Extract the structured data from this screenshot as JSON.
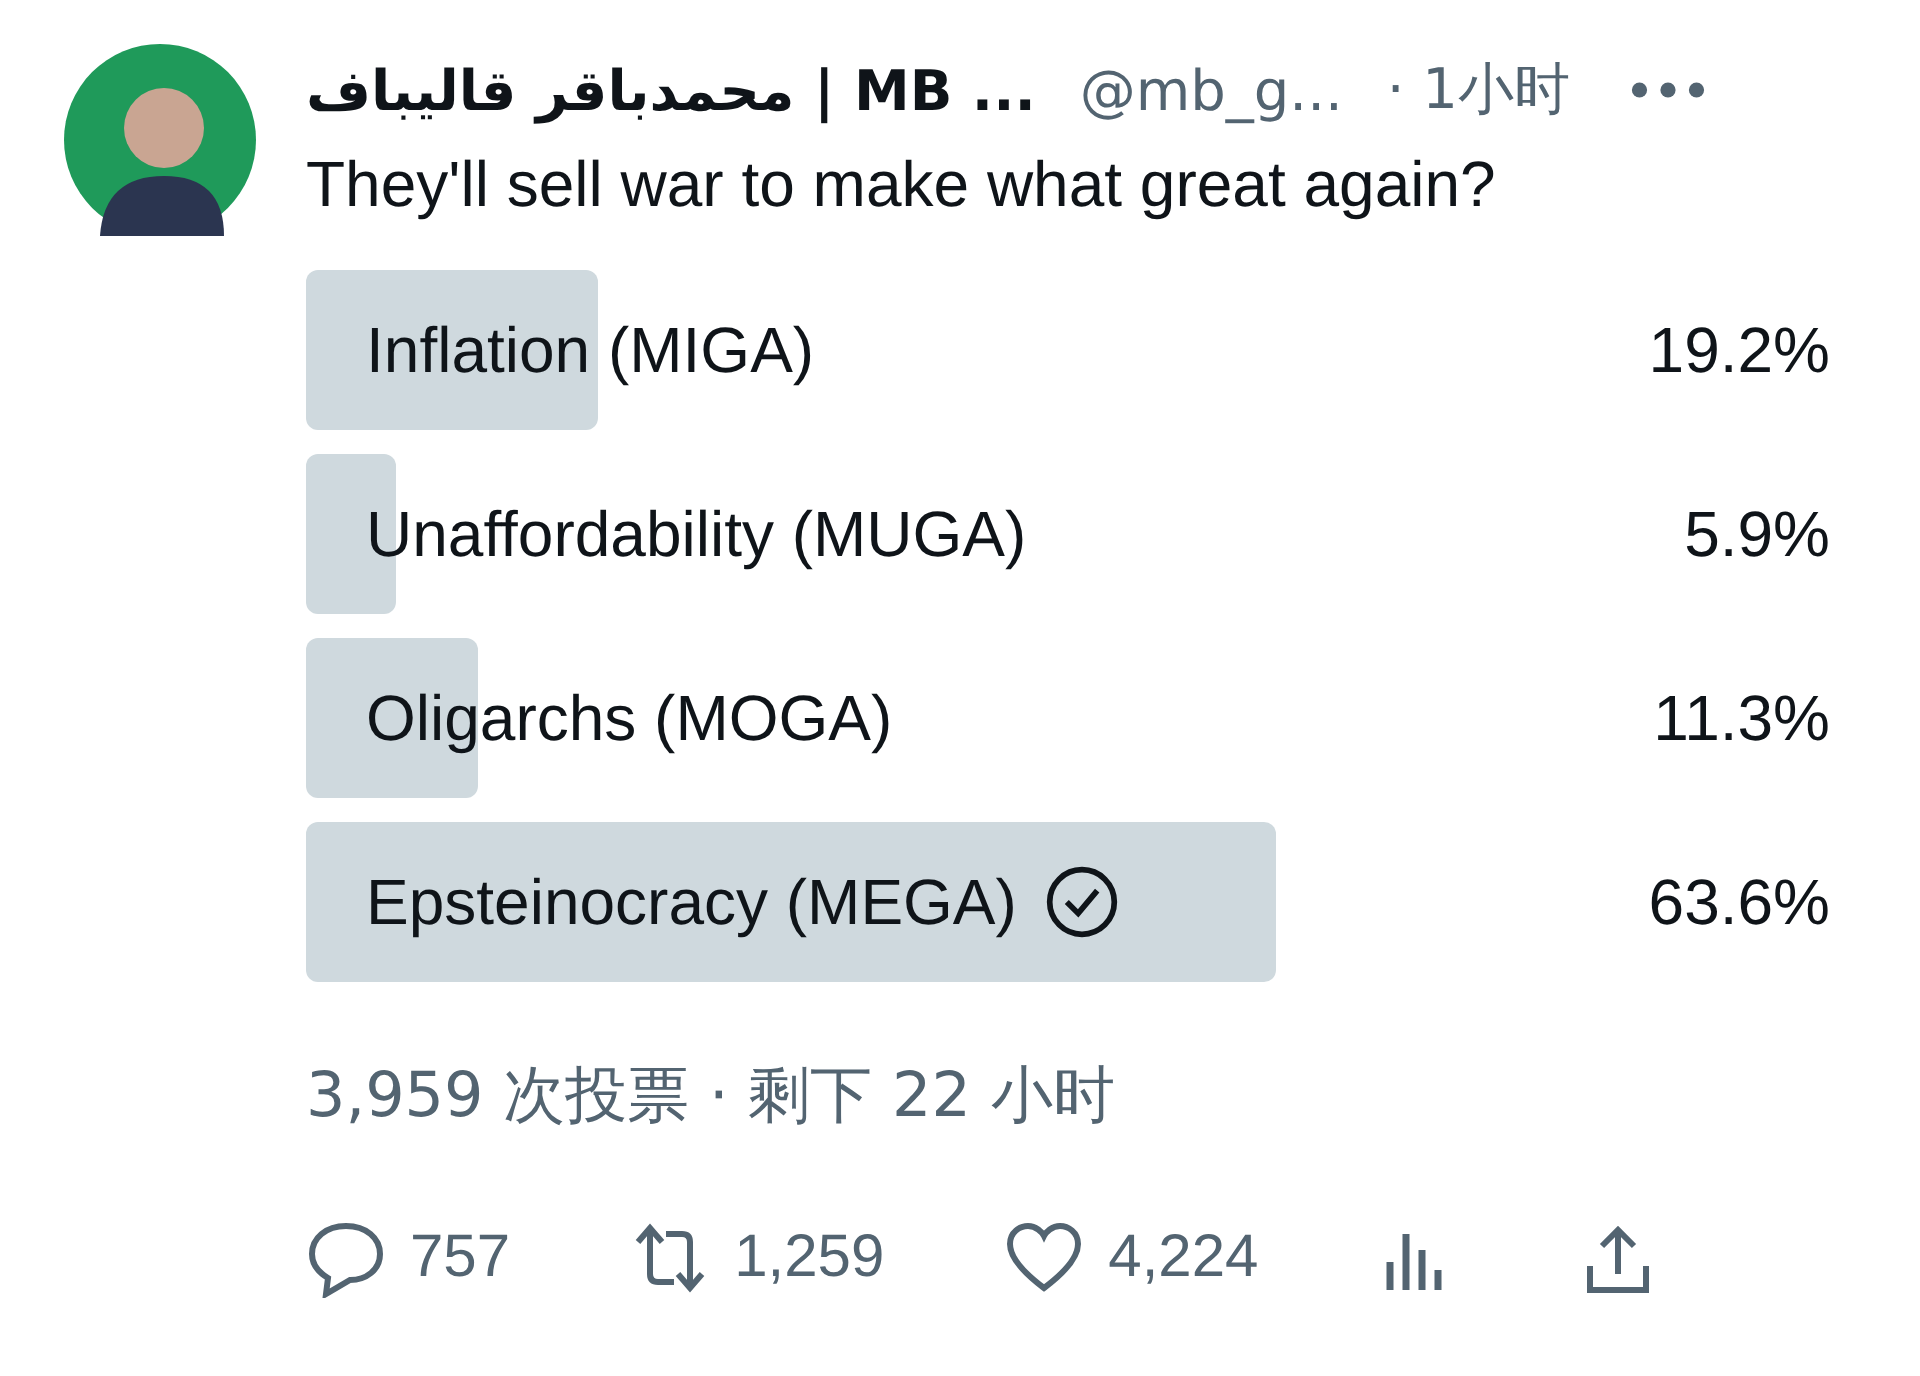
{
  "post": {
    "author_name": "محمدباقر قالیباف | MB ...",
    "handle": "@mb_g...",
    "time": "· 1小时",
    "text": "They'll sell war to make what great again?"
  },
  "poll": {
    "options": [
      {
        "label": "Inflation (MIGA)",
        "percent": "19.2%",
        "level": 0.192,
        "voted": false
      },
      {
        "label": "Unaffordability (MUGA)",
        "percent": "5.9%",
        "level": 0.059,
        "voted": false
      },
      {
        "label": "Oligarchs (MOGA)",
        "percent": "11.3%",
        "level": 0.113,
        "voted": false
      },
      {
        "label": "Epsteinocracy (MEGA)",
        "percent": "63.6%",
        "level": 0.636,
        "voted": true
      }
    ],
    "summary": "3,959 次投票 · 剩下 22 小时"
  },
  "actions": {
    "replies": "757",
    "reposts": "1,259",
    "likes": "4,224"
  }
}
